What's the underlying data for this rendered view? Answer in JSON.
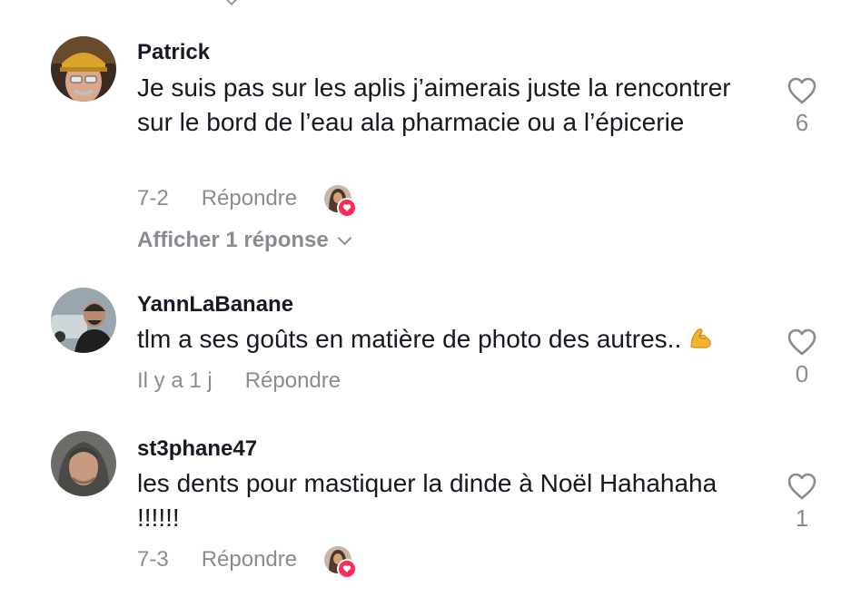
{
  "comments": [
    {
      "username": "Patrick",
      "text": "Je suis pas sur les aplis j’aimerais juste la rencontrer sur le bord de l’eau ala pharmacie ou a l’épicerie",
      "date": "7-2",
      "reply_label": "Répondre",
      "likes": "6",
      "creator_liked": true,
      "view_replies_label": "Afficher 1 réponse"
    },
    {
      "username": "YannLaBanane",
      "text": "tlm a ses goûts en matière de photo des autres..",
      "emoji": "flexed-biceps",
      "date": "Il y a 1 j",
      "reply_label": "Répondre",
      "likes": "0",
      "creator_liked": false
    },
    {
      "username": "st3phane47",
      "text": "les dents pour mastiquer la dinde à Noël Hahahaha !!!!!!",
      "date": "7-3",
      "reply_label": "Répondre",
      "likes": "1",
      "creator_liked": true
    }
  ],
  "colors": {
    "primary_text": "#161823",
    "secondary_text": "#8a8b91",
    "like_badge": "#fe2c55"
  }
}
